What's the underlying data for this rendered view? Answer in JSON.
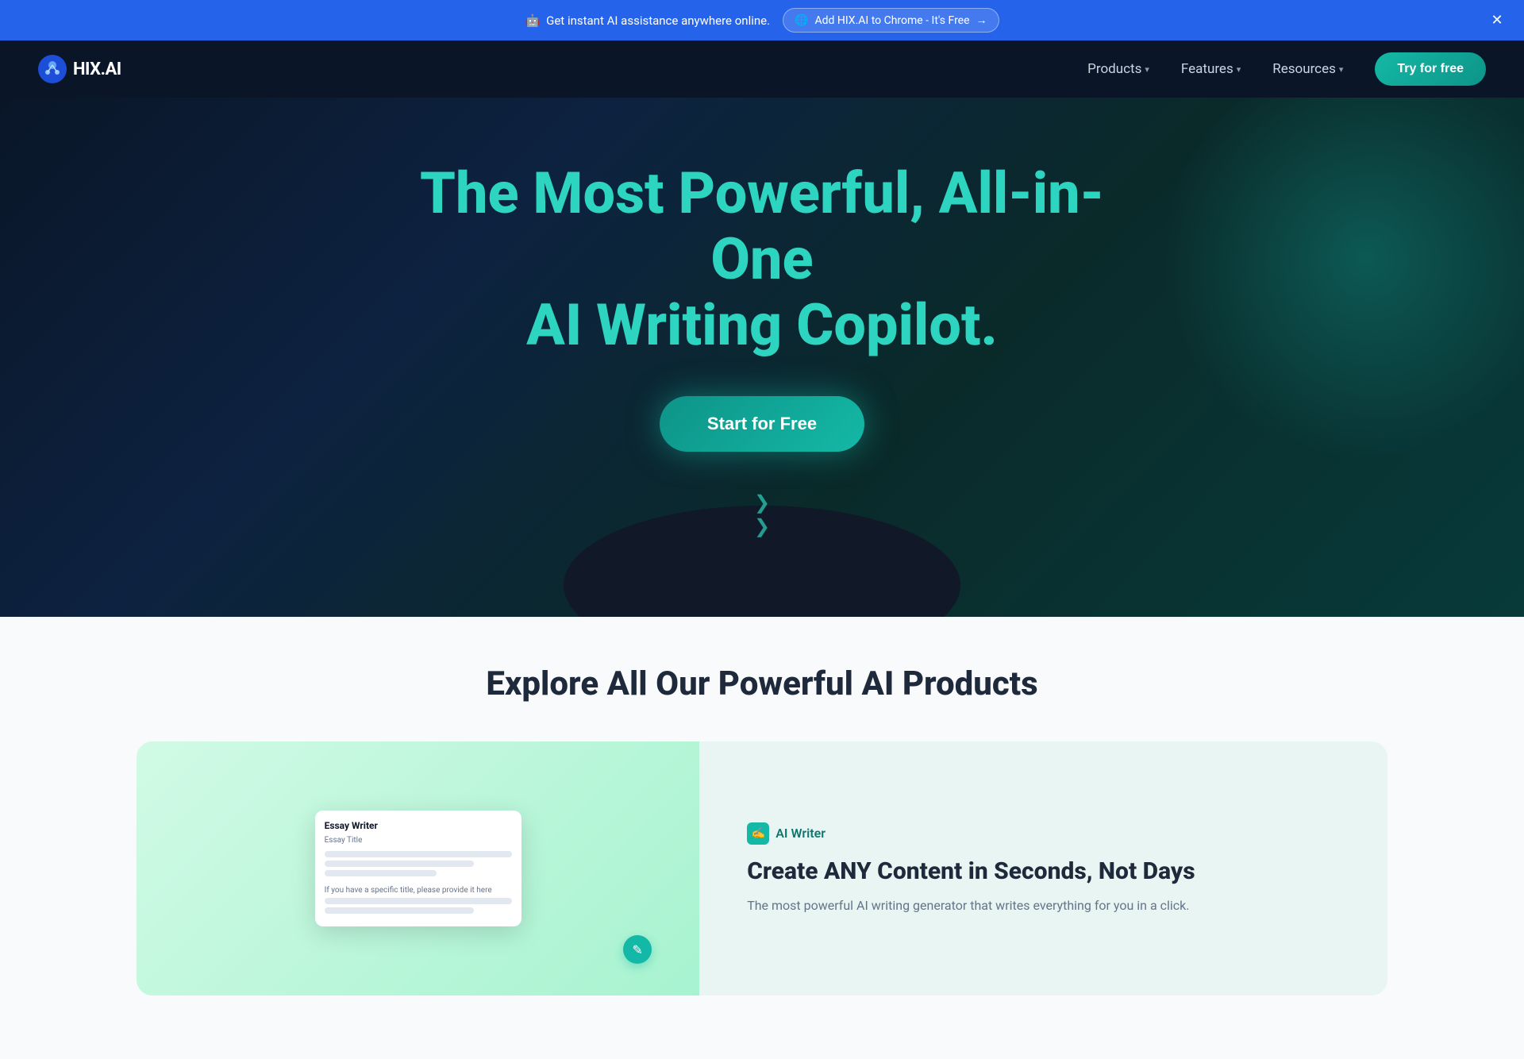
{
  "banner": {
    "emoji": "🤖",
    "text": "Get instant AI assistance anywhere online.",
    "cta_label": "Add HIX.AI to Chrome - It's Free",
    "cta_arrow": "→",
    "chrome_emoji": "🌐"
  },
  "navbar": {
    "logo_text": "HIX.AI",
    "links": [
      {
        "label": "Products",
        "has_dropdown": true
      },
      {
        "label": "Features",
        "has_dropdown": true
      },
      {
        "label": "Resources",
        "has_dropdown": true
      }
    ],
    "cta_label": "Try for free"
  },
  "hero": {
    "title_line1": "The Most Powerful, All-in-One",
    "title_line2": "AI Writing Copilot.",
    "cta_label": "Start for Free",
    "scroll_chevron": "❯❯"
  },
  "products_section": {
    "title": "Explore All Our Powerful AI Products",
    "cards": [
      {
        "badge_label": "AI Writer",
        "badge_icon": "✍",
        "title": "Create ANY Content in Seconds, Not Days",
        "description": "The most powerful AI writing generator that writes everything for you in a click.",
        "mock_title": "Essay Writer",
        "mock_subtitle": "Essay Title",
        "mock_placeholder": "If you have a specific title, please provide it here"
      }
    ]
  }
}
